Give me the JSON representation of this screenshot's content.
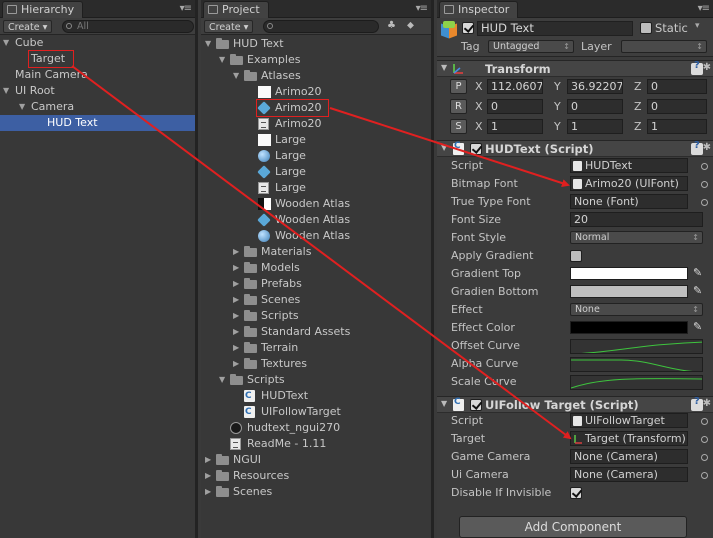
{
  "hierarchy": {
    "tab_label": "Hierarchy",
    "create_label": "Create",
    "search_placeholder": "All",
    "items": [
      {
        "label": "Cube",
        "depth": 0,
        "fold": "open"
      },
      {
        "label": "Target",
        "depth": 1,
        "fold": "none"
      },
      {
        "label": "Main Camera",
        "depth": 0,
        "fold": "none"
      },
      {
        "label": "UI Root",
        "depth": 0,
        "fold": "open"
      },
      {
        "label": "Camera",
        "depth": 1,
        "fold": "open"
      },
      {
        "label": "HUD Text",
        "depth": 2,
        "fold": "none",
        "selected": true
      }
    ]
  },
  "project": {
    "tab_label": "Project",
    "create_label": "Create",
    "items": [
      {
        "label": "HUD Text",
        "depth": 0,
        "icon": "folder",
        "fold": "open"
      },
      {
        "label": "Examples",
        "depth": 1,
        "icon": "folder",
        "fold": "open"
      },
      {
        "label": "Atlases",
        "depth": 2,
        "icon": "folder",
        "fold": "open"
      },
      {
        "label": "Arimo20",
        "depth": 3,
        "icon": "white",
        "fold": "none"
      },
      {
        "label": "Arimo20",
        "depth": 3,
        "icon": "cube",
        "fold": "none",
        "highlight": true
      },
      {
        "label": "Arimo20",
        "depth": 3,
        "icon": "doc",
        "fold": "none"
      },
      {
        "label": "Large",
        "depth": 3,
        "icon": "white",
        "fold": "none"
      },
      {
        "label": "Large",
        "depth": 3,
        "icon": "sphere",
        "fold": "none"
      },
      {
        "label": "Large",
        "depth": 3,
        "icon": "cube",
        "fold": "none"
      },
      {
        "label": "Large",
        "depth": 3,
        "icon": "doc",
        "fold": "none"
      },
      {
        "label": "Wooden Atlas",
        "depth": 3,
        "icon": "wood",
        "fold": "none"
      },
      {
        "label": "Wooden Atlas",
        "depth": 3,
        "icon": "cube",
        "fold": "none"
      },
      {
        "label": "Wooden Atlas",
        "depth": 3,
        "icon": "sphere",
        "fold": "none"
      },
      {
        "label": "Materials",
        "depth": 2,
        "icon": "folder",
        "fold": "closed"
      },
      {
        "label": "Models",
        "depth": 2,
        "icon": "folder",
        "fold": "closed"
      },
      {
        "label": "Prefabs",
        "depth": 2,
        "icon": "folder",
        "fold": "closed"
      },
      {
        "label": "Scenes",
        "depth": 2,
        "icon": "folder",
        "fold": "closed"
      },
      {
        "label": "Scripts",
        "depth": 2,
        "icon": "folder",
        "fold": "closed"
      },
      {
        "label": "Standard Assets",
        "depth": 2,
        "icon": "folder",
        "fold": "closed"
      },
      {
        "label": "Terrain",
        "depth": 2,
        "icon": "folder",
        "fold": "closed"
      },
      {
        "label": "Textures",
        "depth": 2,
        "icon": "folder",
        "fold": "closed"
      },
      {
        "label": "Scripts",
        "depth": 1,
        "icon": "folder",
        "fold": "open"
      },
      {
        "label": "HUDText",
        "depth": 2,
        "icon": "script",
        "fold": "none"
      },
      {
        "label": "UIFollowTarget",
        "depth": 2,
        "icon": "script",
        "fold": "none"
      },
      {
        "label": "hudtext_ngui270",
        "depth": 1,
        "icon": "unity",
        "fold": "none"
      },
      {
        "label": "ReadMe - 1.11",
        "depth": 1,
        "icon": "doc",
        "fold": "none"
      },
      {
        "label": "NGUI",
        "depth": 0,
        "icon": "folder",
        "fold": "closed"
      },
      {
        "label": "Resources",
        "depth": 0,
        "icon": "folder",
        "fold": "closed"
      },
      {
        "label": "Scenes",
        "depth": 0,
        "icon": "folder",
        "fold": "closed"
      }
    ]
  },
  "inspector": {
    "tab_label": "Inspector",
    "object_name": "HUD Text",
    "static_label": "Static",
    "tag_label": "Tag",
    "tag_value": "Untagged",
    "layer_label": "Layer",
    "layer_value": "",
    "transform": {
      "title": "Transform",
      "rows": [
        {
          "btn": "P",
          "x": "112.0607",
          "y": "36.92207",
          "z": "0"
        },
        {
          "btn": "R",
          "x": "0",
          "y": "0",
          "z": "0"
        },
        {
          "btn": "S",
          "x": "1",
          "y": "1",
          "z": "1"
        }
      ],
      "axis_x": "X",
      "axis_y": "Y",
      "axis_z": "Z"
    },
    "hudtext": {
      "title": "HUDText (Script)",
      "props": {
        "script_label": "Script",
        "script_value": "HUDText",
        "bitmap_font_label": "Bitmap Font",
        "bitmap_font_value": "Arimo20 (UIFont)",
        "ttf_label": "True Type Font",
        "ttf_value": "None (Font)",
        "font_size_label": "Font Size",
        "font_size_value": "20",
        "font_style_label": "Font Style",
        "font_style_value": "Normal",
        "apply_gradient_label": "Apply Gradient",
        "gradient_top_label": "Gradient Top",
        "gradient_bottom_label": "Gradien Bottom",
        "effect_label": "Effect",
        "effect_value": "None",
        "effect_color_label": "Effect Color",
        "offset_curve_label": "Offset Curve",
        "alpha_curve_label": "Alpha Curve",
        "scale_curve_label": "Scale Curve"
      },
      "colors": {
        "gradient_top": "#ffffff",
        "gradient_bottom": "#bfbfbf",
        "effect_color": "#000000"
      },
      "apply_gradient": false
    },
    "followtarget": {
      "title": "UIFollow Target (Script)",
      "props": {
        "script_label": "Script",
        "script_value": "UIFollowTarget",
        "target_label": "Target",
        "target_value": "Target (Transform)",
        "game_camera_label": "Game Camera",
        "game_camera_value": "None (Camera)",
        "ui_camera_label": "Ui Camera",
        "ui_camera_value": "None (Camera)",
        "disable_label": "Disable If Invisible"
      },
      "disable_if_invisible": true
    },
    "add_component_label": "Add Component"
  },
  "colors": {
    "selection": "#3d5fa3",
    "annotation": "#e02020",
    "curve": "#3ec43e"
  }
}
